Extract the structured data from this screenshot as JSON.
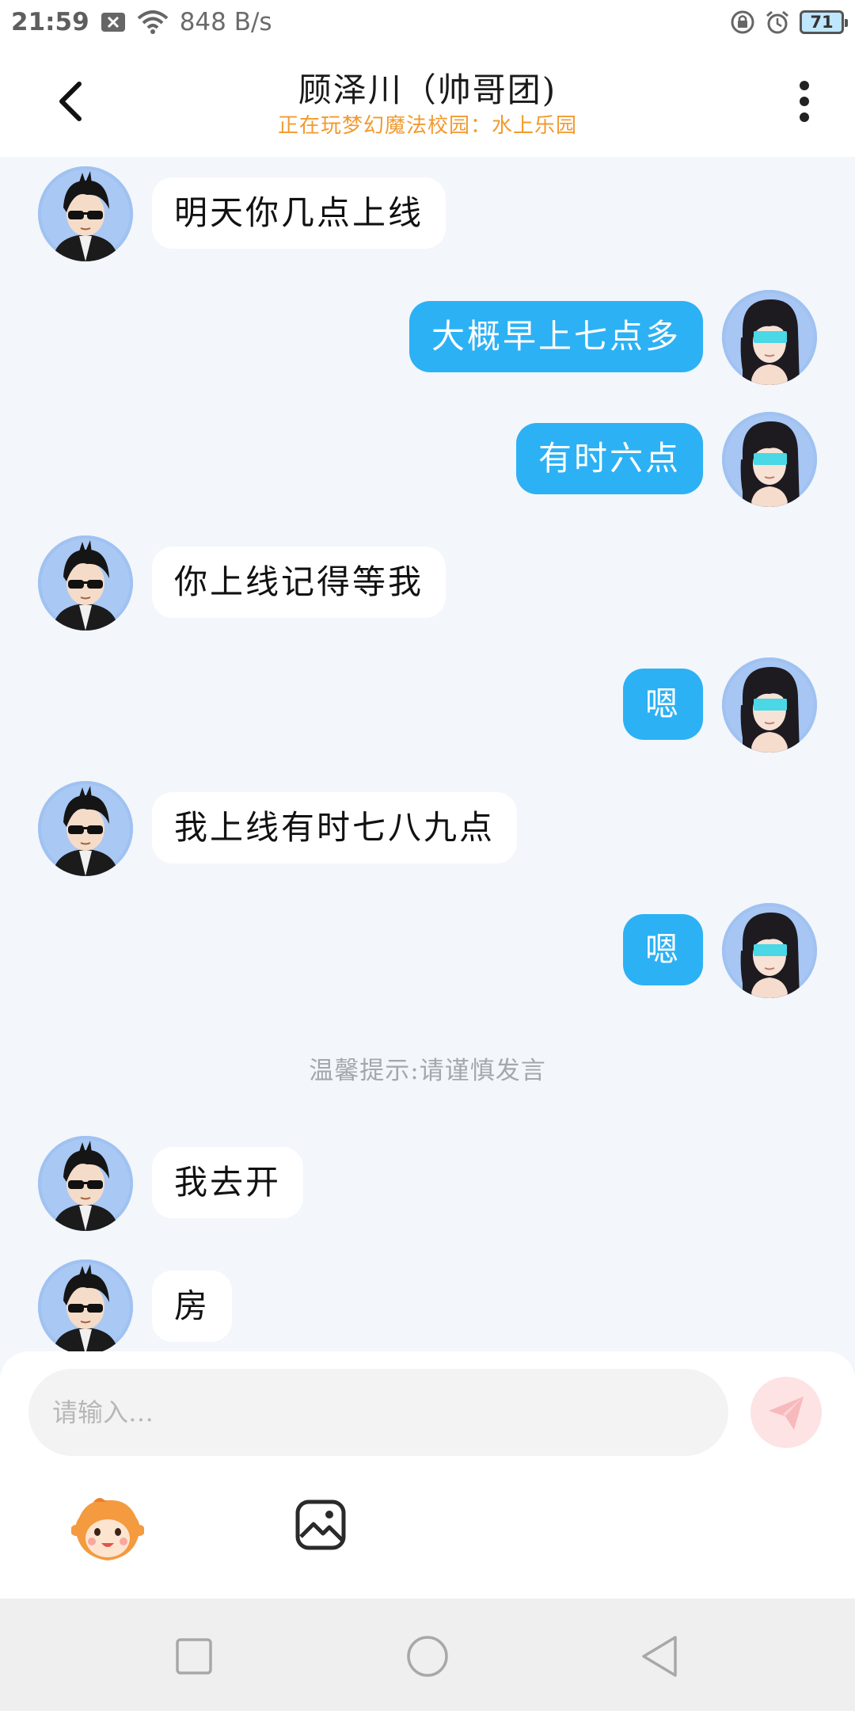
{
  "status_bar": {
    "time": "21:59",
    "net_speed": "848 B/s",
    "battery": "71",
    "icons": [
      "close-box-icon",
      "wifi-icon",
      "lock-rotation-icon",
      "alarm-icon",
      "battery-icon"
    ]
  },
  "header": {
    "title": "顾泽川（帅哥团)",
    "subtitle": "正在玩梦幻魔法校园：水上乐园"
  },
  "messages": [
    {
      "side": "in",
      "text": "明天你几点上线"
    },
    {
      "side": "out",
      "text": "大概早上七点多"
    },
    {
      "side": "out",
      "text": "有时六点"
    },
    {
      "side": "in",
      "text": "你上线记得等我"
    },
    {
      "side": "out",
      "text": "嗯"
    },
    {
      "side": "in",
      "text": "我上线有时七八九点"
    },
    {
      "side": "out",
      "text": "嗯"
    },
    {
      "side": "in",
      "text": "我去开"
    },
    {
      "side": "in",
      "text": "房"
    }
  ],
  "notice": "温馨提示:请谨慎发言",
  "input": {
    "placeholder": "请输入…"
  },
  "colors": {
    "outgoing_bubble": "#2cb1f5",
    "incoming_bubble": "#ffffff",
    "subtitle": "#f29a2e",
    "chat_background": "#f3f6fa",
    "send_button": "#fde3e4"
  }
}
